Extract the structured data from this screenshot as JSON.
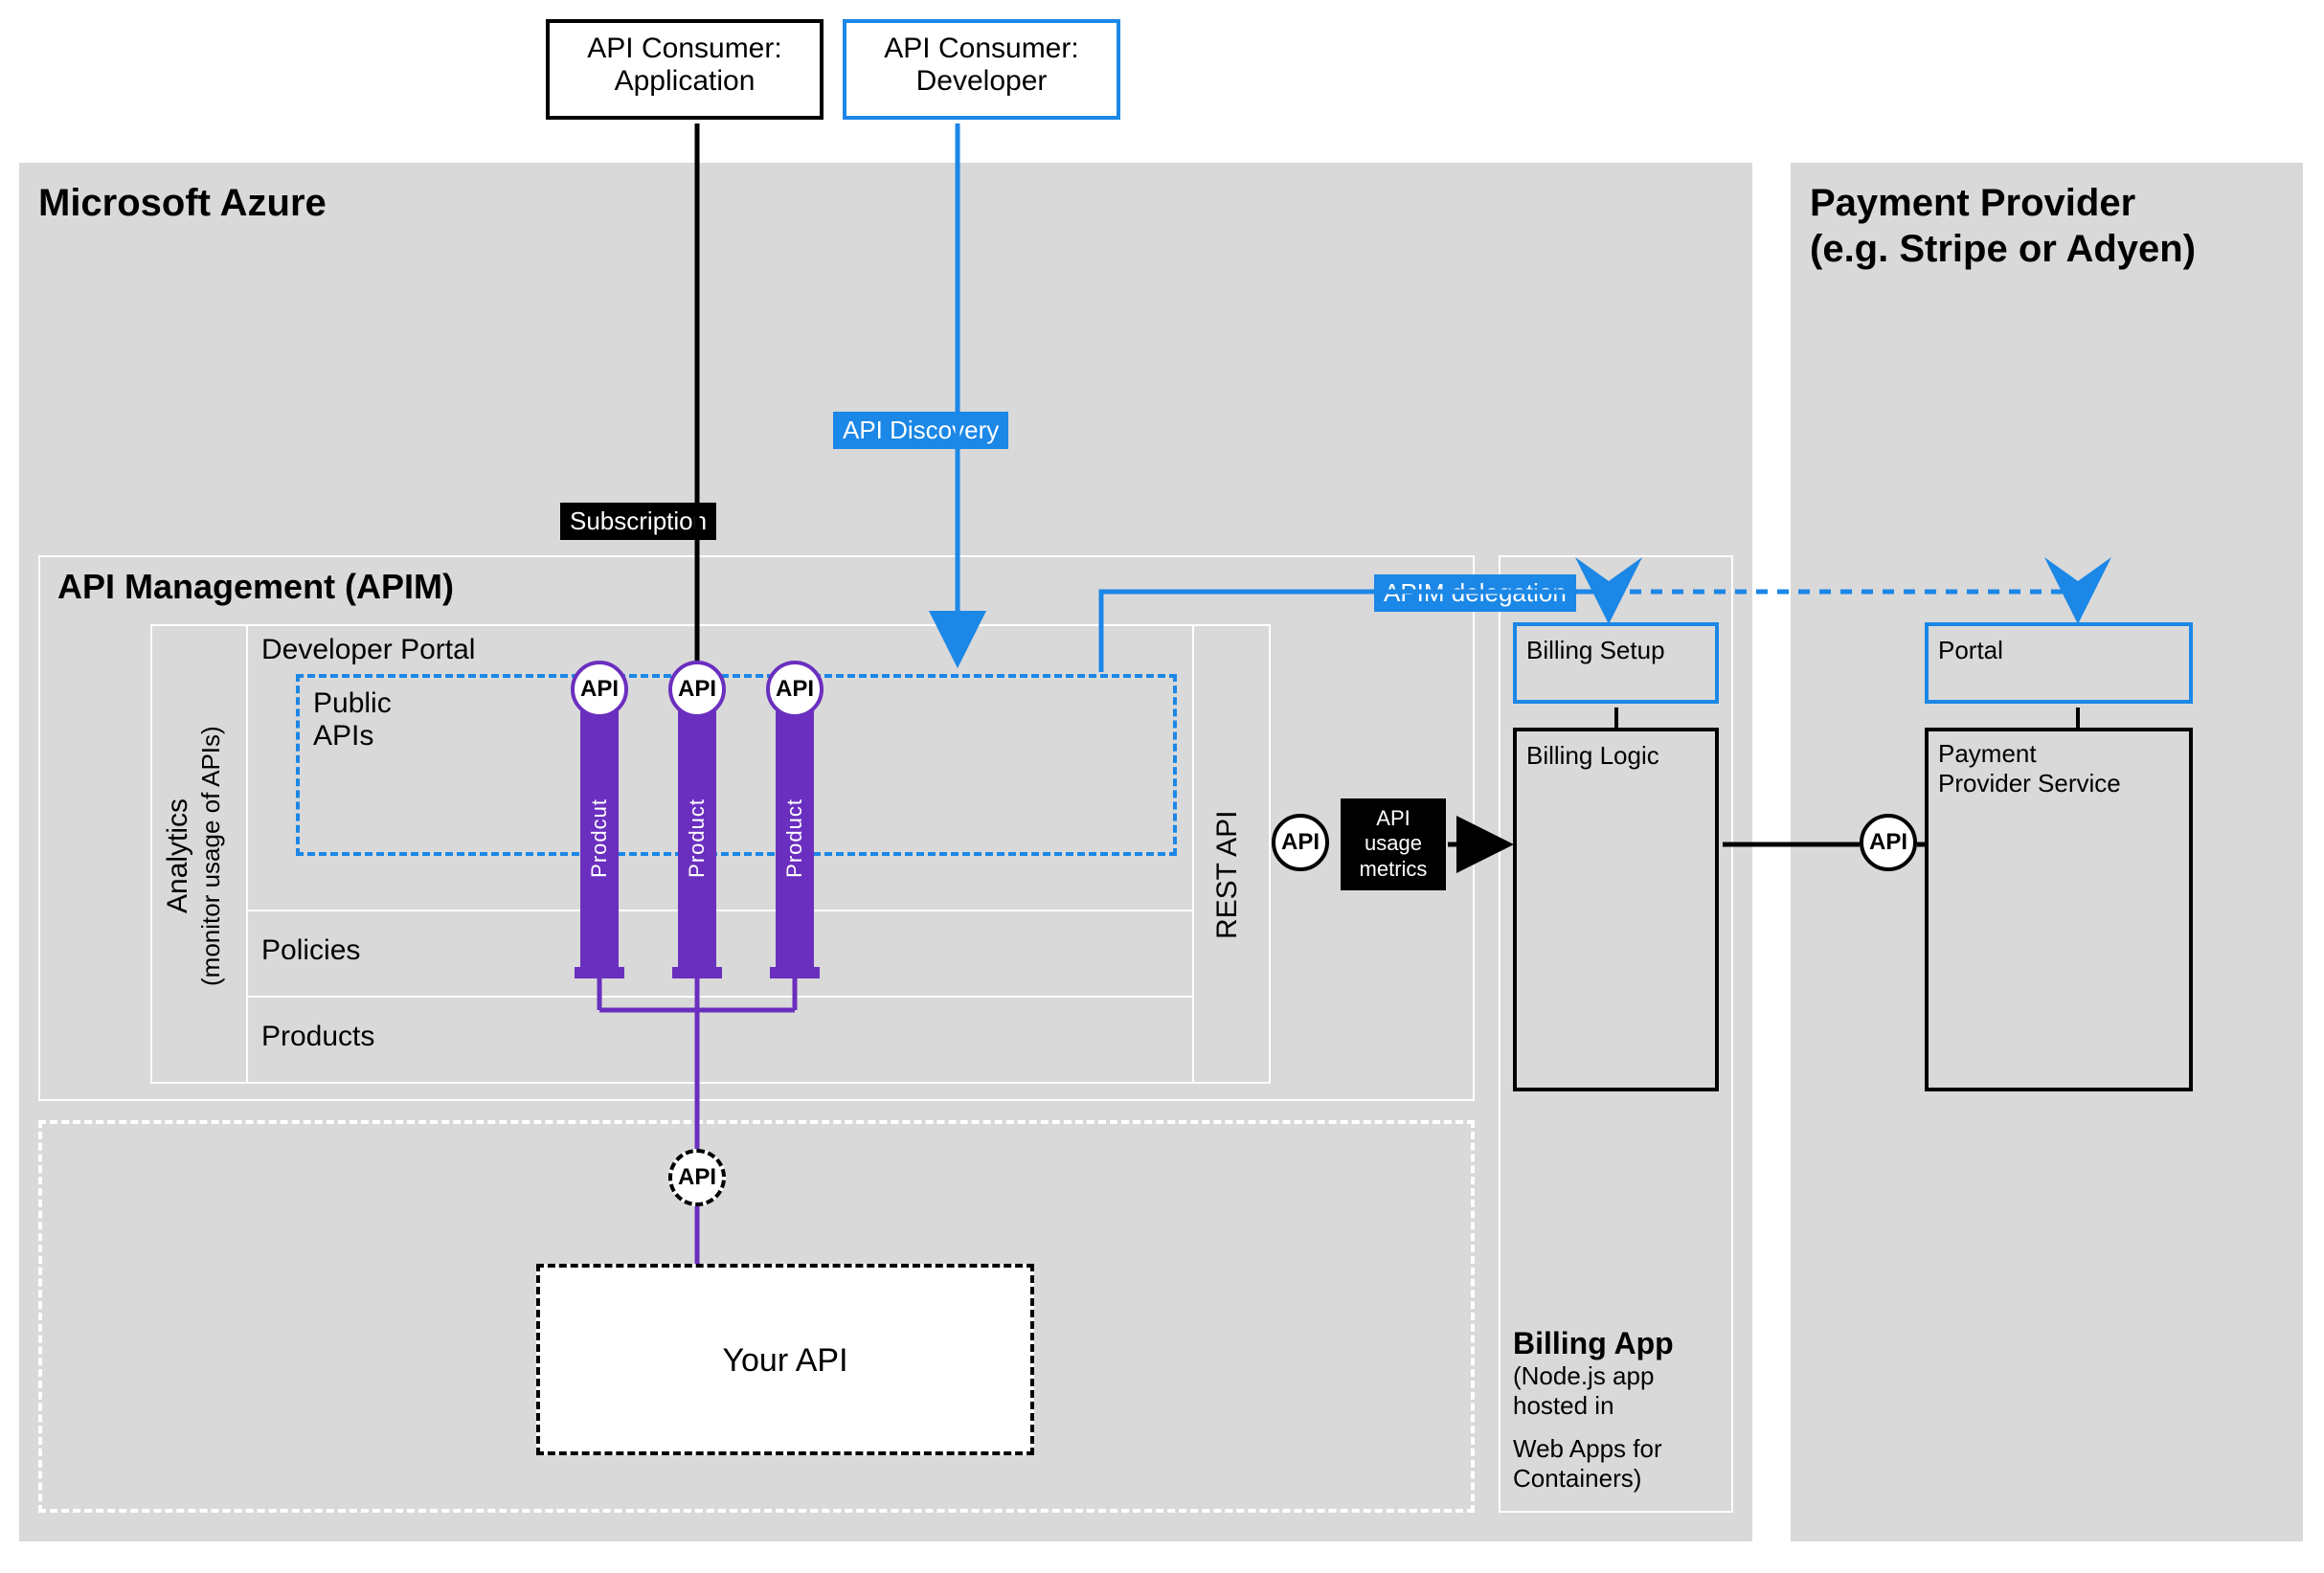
{
  "top": {
    "consumerAppL1": "API Consumer:",
    "consumerAppL2": "Application",
    "consumerDevL1": "API Consumer:",
    "consumerDevL2": "Developer"
  },
  "tags": {
    "subscription": "Subscription",
    "apiDiscovery": "API Discovery",
    "apimDelegation": "APIM delegation",
    "apiUsage1": "API",
    "apiUsage2": "usage",
    "apiUsage3": "metrics"
  },
  "azure": {
    "title": "Microsoft Azure",
    "apim": {
      "title": "API Management (APIM)",
      "analyticsL1": "Analytics",
      "analyticsL2": "(monitor usage of APIs)",
      "devPortal": "Developer Portal",
      "publicApisL1": "Public",
      "publicApisL2": "APIs",
      "restApi": "REST API",
      "policies": "Policies",
      "products": "Products",
      "product1": "Prodcut",
      "product2": "Product",
      "product3": "Product",
      "api": "API"
    },
    "yourApi": "Your API"
  },
  "billing": {
    "title": "Billing App",
    "subL1": "(Node.js app hosted in",
    "subL2": "Web Apps for Containers)",
    "setup": "Billing Setup",
    "logic": "Billing Logic",
    "api": "API"
  },
  "payment": {
    "titleL1": "Payment Provider",
    "titleL2": "(e.g. Stripe or Adyen)",
    "portal": "Portal",
    "serviceL1": "Payment",
    "serviceL2": "Provider Service",
    "api": "API"
  }
}
